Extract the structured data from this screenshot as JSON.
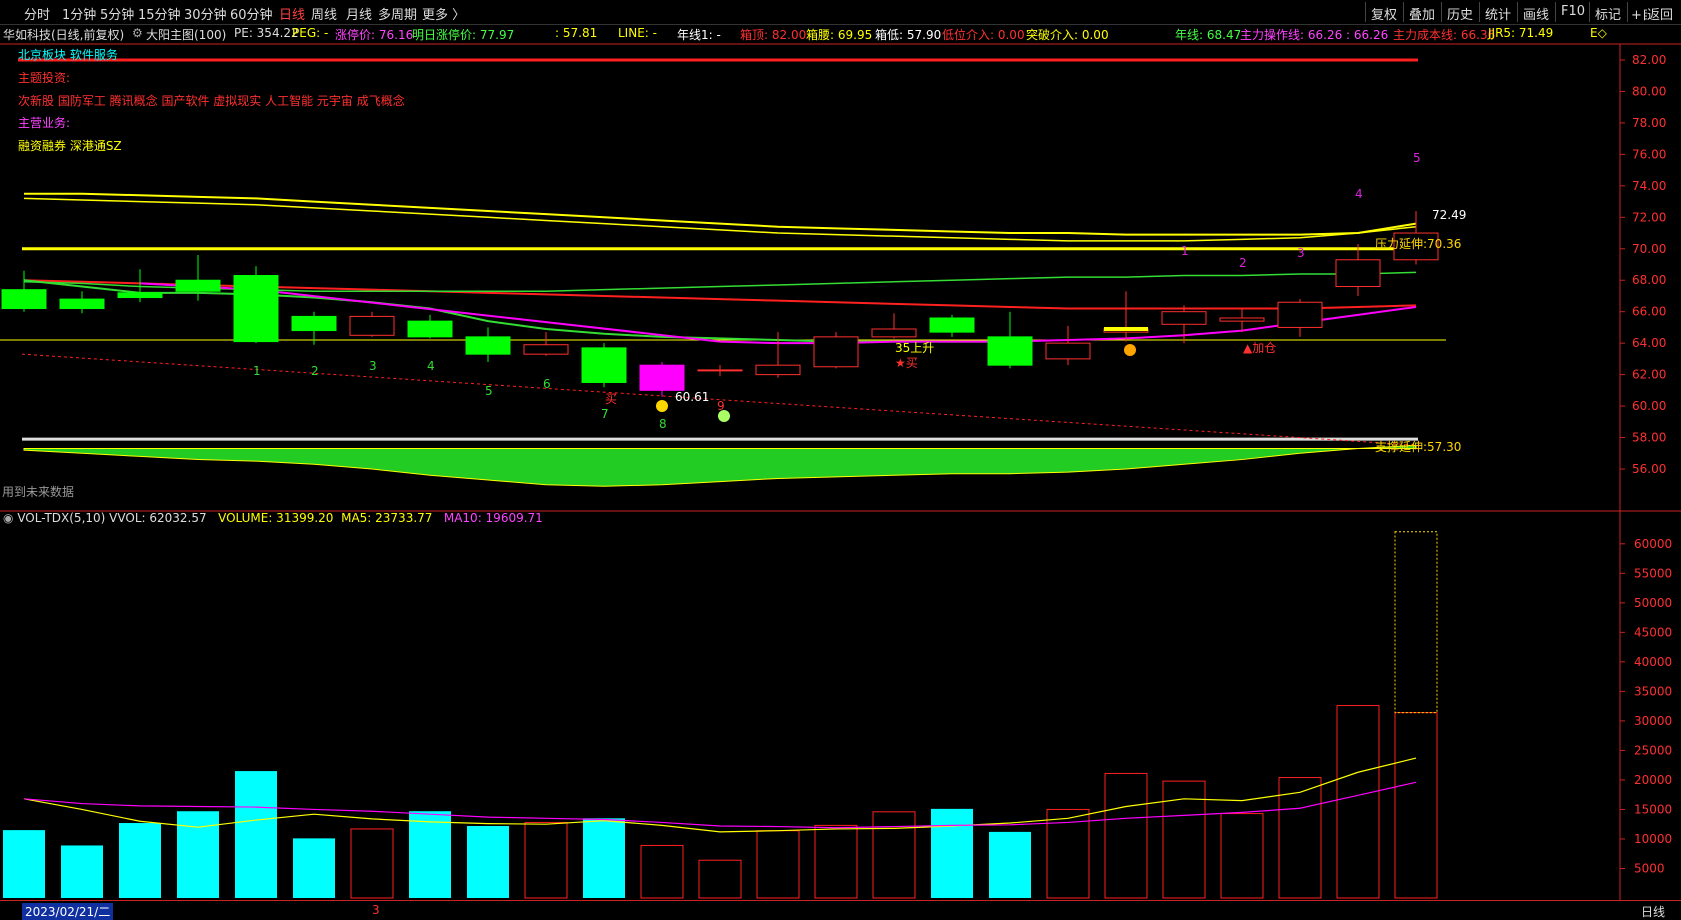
{
  "toolbar": {
    "timeframes": [
      "分时",
      "1分钟",
      "5分钟",
      "15分钟",
      "30分钟",
      "60分钟",
      "日线",
      "周线",
      "月线",
      "多周期",
      "更多 〉"
    ],
    "active_timeframe": "日线",
    "right_buttons": [
      "复权",
      "叠加",
      "历史",
      "统计",
      "画线",
      "F10",
      "标记",
      "+自选",
      "返回"
    ]
  },
  "info": {
    "stock": "华如科技(日线,前复权)",
    "indicator": "大阳主图(100)",
    "pe": "PE: 354.22",
    "peg": "PEG: -",
    "limit_up": "涨停价: 76.16",
    "next_limit_up": "明日涨停价: 77.97",
    "val_5781": ": 57.81",
    "line": "LINE: -",
    "year_line1": "年线1: -",
    "box_top": "箱顶: 82.00",
    "box_mid": "箱腰: 69.95",
    "box_low": "箱低: 57.90",
    "low_entry": "低位介入: 0.00",
    "break_entry": "突破介入: 0.00",
    "year_line": "年线: 68.47",
    "main_line": "主力操作线: 66.26 : 66.26",
    "main_cost": "主力成本线: 66.36",
    "jjr5": "JJR5: 71.49",
    "trailing": "E◇"
  },
  "overlay": {
    "sector_label": "北京板块",
    "sector_value": "软件服务",
    "theme_title": "主题投资:",
    "themes": "次新股 国防军工 腾讯概念 国产软件 虚拟现实 人工智能 元宇宙 成飞概念",
    "business_title": "主营业务:",
    "business": "融资融券 深港通SZ",
    "future_data": "用到未来数据",
    "pressure": "压力延伸:70.36",
    "support": "支撑延伸:57.30",
    "high_label": "72.49",
    "low_label": "60.61",
    "ma35_label": "35上升",
    "buy_label": "★买",
    "add_label": "▲加仓",
    "sell_label": "买"
  },
  "volume_panel": {
    "name": "VOL-TDX(5,10)",
    "vvol": "VVOL: 62032.57",
    "volume": "VOLUME: 31399.20",
    "ma5": "MA5: 23733.77",
    "ma10": "MA10: 19609.71"
  },
  "footer": {
    "date": "2023/02/21/二",
    "marker": "3",
    "period": "日线"
  },
  "colors": {
    "up": "#ff3030",
    "down": "#00ff00",
    "vol_down": "#00ffff",
    "yellow": "#ffff00",
    "magenta": "#ff00ff",
    "green_line": "#33dd33",
    "red_line": "#ff2020",
    "white": "#ffffff"
  },
  "chart_data": {
    "type": "candlestick",
    "price_axis": {
      "min": 55,
      "max": 83,
      "ticks": [
        82,
        80,
        78,
        76,
        74,
        72,
        70,
        68,
        66,
        64,
        62,
        60,
        58,
        56
      ]
    },
    "volume_axis": {
      "min": 0,
      "max": 62000,
      "ticks": [
        60000,
        55000,
        50000,
        45000,
        40000,
        35000,
        30000,
        25000,
        20000,
        15000,
        10000,
        5000
      ]
    },
    "candles": [
      {
        "o": 67.4,
        "c": 66.2,
        "h": 68.6,
        "l": 66.0
      },
      {
        "o": 66.8,
        "c": 66.2,
        "h": 67.3,
        "l": 65.9
      },
      {
        "o": 67.2,
        "c": 66.9,
        "h": 68.7,
        "l": 66.6
      },
      {
        "o": 68.0,
        "c": 67.3,
        "h": 69.6,
        "l": 66.7
      },
      {
        "o": 68.3,
        "c": 64.1,
        "h": 68.9,
        "l": 64.0
      },
      {
        "o": 65.7,
        "c": 64.8,
        "h": 66.0,
        "l": 63.9
      },
      {
        "o": 64.5,
        "c": 65.7,
        "h": 66.0,
        "l": 64.4
      },
      {
        "o": 65.4,
        "c": 64.4,
        "h": 65.8,
        "l": 64.3
      },
      {
        "o": 64.4,
        "c": 63.3,
        "h": 65.0,
        "l": 62.8
      },
      {
        "o": 63.3,
        "c": 63.9,
        "h": 64.7,
        "l": 63.2
      },
      {
        "o": 63.7,
        "c": 61.5,
        "h": 64.0,
        "l": 61.2
      },
      {
        "o": 61.0,
        "c": 62.6,
        "h": 62.8,
        "l": 60.6
      },
      {
        "o": 62.3,
        "c": 62.3,
        "h": 62.6,
        "l": 61.9
      },
      {
        "o": 62.0,
        "c": 62.6,
        "h": 64.7,
        "l": 61.8
      },
      {
        "o": 62.5,
        "c": 64.4,
        "h": 64.7,
        "l": 62.4
      },
      {
        "o": 64.4,
        "c": 64.9,
        "h": 65.9,
        "l": 64.3
      },
      {
        "o": 65.6,
        "c": 64.7,
        "h": 65.8,
        "l": 64.4
      },
      {
        "o": 64.4,
        "c": 62.6,
        "h": 66.0,
        "l": 62.4
      },
      {
        "o": 63.0,
        "c": 64.0,
        "h": 65.1,
        "l": 62.6
      },
      {
        "o": 64.7,
        "c": 64.9,
        "h": 67.3,
        "l": 64.1
      },
      {
        "o": 65.2,
        "c": 66.0,
        "h": 66.4,
        "l": 64.0
      },
      {
        "o": 65.4,
        "c": 65.6,
        "h": 66.2,
        "l": 64.7
      },
      {
        "o": 65.0,
        "c": 66.6,
        "h": 66.8,
        "l": 64.4
      },
      {
        "o": 67.6,
        "c": 69.3,
        "h": 70.3,
        "l": 67.0
      },
      {
        "o": 69.3,
        "c": 71.0,
        "h": 72.4,
        "l": 69.0
      }
    ],
    "volumes": [
      11500,
      8900,
      12700,
      14700,
      21500,
      10100,
      11700,
      14700,
      12200,
      12800,
      13500,
      8900,
      6400,
      11400,
      12300,
      14600,
      15100,
      11200,
      15000,
      21100,
      19800,
      14300,
      20400,
      32600,
      31400
    ],
    "vvol_last": 62032.57,
    "ma5_last": 23733.77,
    "ma10_last": 19609.71
  }
}
